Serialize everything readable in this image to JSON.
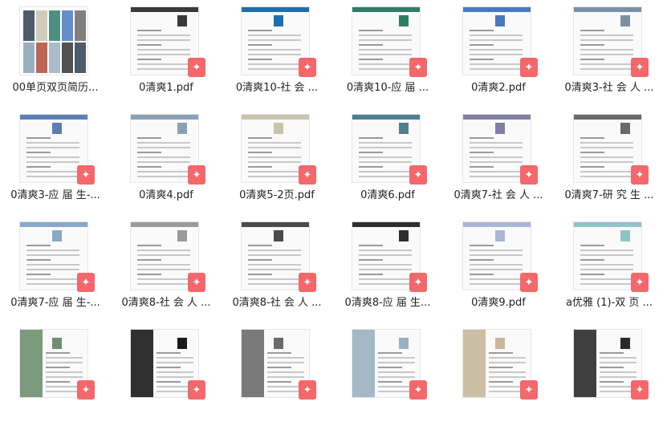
{
  "files": [
    {
      "name": "00单页双页简历..."
    },
    {
      "name": "0清爽1.pdf"
    },
    {
      "name": "0清爽10-社 会 ..."
    },
    {
      "name": "0清爽10-应 届 ..."
    },
    {
      "name": "0清爽2.pdf"
    },
    {
      "name": "0清爽3-社 会 人 ..."
    },
    {
      "name": "0清爽3-应 届 生-..."
    },
    {
      "name": "0清爽4.pdf"
    },
    {
      "name": "0清爽5-2页.pdf"
    },
    {
      "name": "0清爽6.pdf"
    },
    {
      "name": "0清爽7-社 会 人 ..."
    },
    {
      "name": "0清爽7-研 究 生 ..."
    },
    {
      "name": "0清爽7-应 届 生-..."
    },
    {
      "name": "0清爽8-社 会 人 ..."
    },
    {
      "name": "0清爽8-社 会 人 ..."
    },
    {
      "name": "0清爽8-应 届 生..."
    },
    {
      "name": "0清爽9.pdf"
    },
    {
      "name": "a优雅 (1)-双 页 ..."
    },
    {
      "name": ""
    },
    {
      "name": ""
    },
    {
      "name": ""
    },
    {
      "name": ""
    },
    {
      "name": ""
    },
    {
      "name": ""
    }
  ],
  "accents": [
    "#2f3e4d",
    "#3a3a3a",
    "#1f6fae",
    "#2e7d6b",
    "#4a78c2",
    "#7a8fa6",
    "#5b7fb5",
    "#8aa0b8",
    "#c9c3ad",
    "#4f7f92",
    "#7f7fa8",
    "#6a6a6a",
    "#8aa8c8",
    "#9a9a9a",
    "#4b4b4b",
    "#2f2f2f",
    "#a9b6d6",
    "#8fc3c8",
    "#6f8f6f",
    "#1a1a1a",
    "#6a6a6a",
    "#9ab0c0",
    "#c8b89a",
    "#2a2a2a"
  ],
  "pdf_badge_glyph": "✦"
}
